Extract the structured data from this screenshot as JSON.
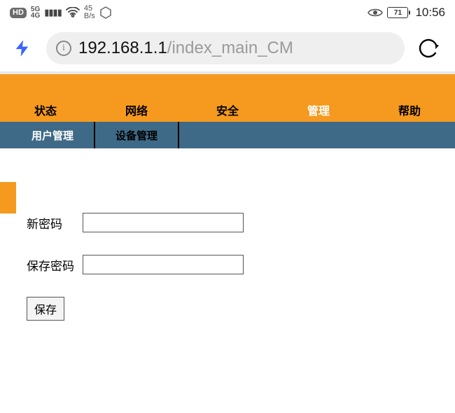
{
  "status": {
    "hd_label": "HD",
    "net_line1": "5G",
    "net_line2": "4G",
    "bs_num": "45",
    "bs_unit": "B/s",
    "battery_pct": "71",
    "clock": "10:56"
  },
  "url": {
    "host": "192.168.1.1",
    "path": "/index_main_CM"
  },
  "nav": {
    "items": [
      "状态",
      "网络",
      "安全",
      "管理",
      "帮助"
    ],
    "active_index": 3
  },
  "subnav": {
    "items": [
      "用户管理",
      "设备管理"
    ],
    "active_index": 0
  },
  "form": {
    "new_pwd_label": "新密码",
    "confirm_pwd_label": "保存密码",
    "new_pwd_value": "",
    "confirm_pwd_value": "",
    "save_label": "保存"
  }
}
